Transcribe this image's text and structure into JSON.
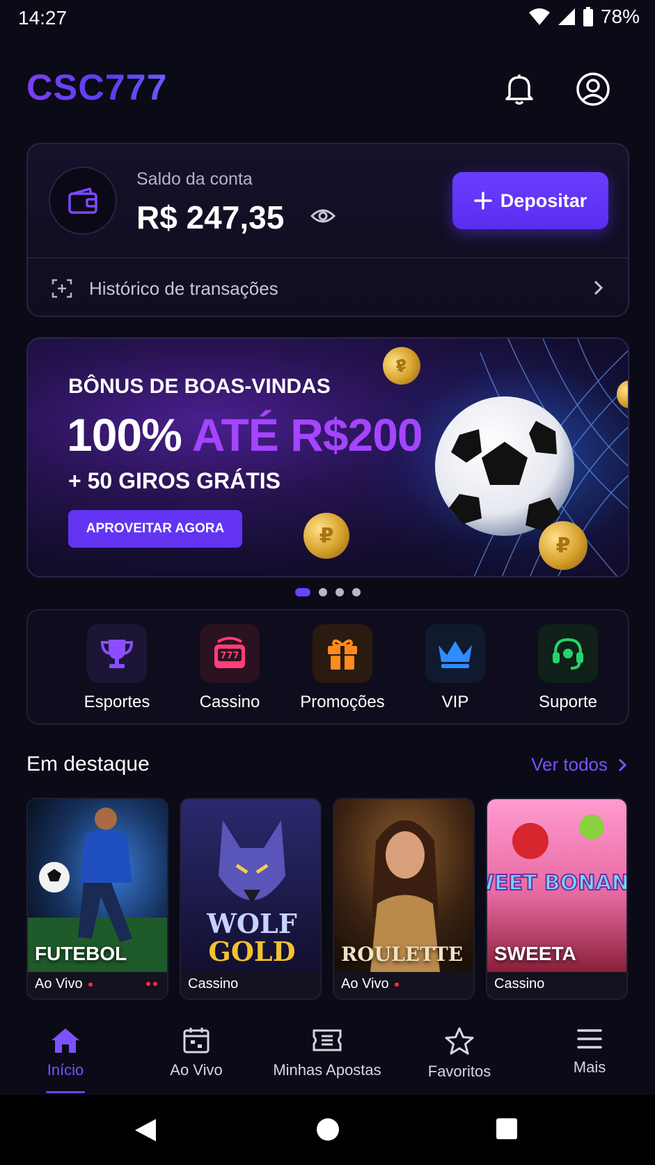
{
  "status_bar": {
    "time": "14:27",
    "battery": "78%"
  },
  "header": {
    "logo": "CSC777"
  },
  "balance": {
    "label": "Saldo da conta",
    "value": "R$ 247,35",
    "deposit_label": "Depositar",
    "history_label": "Histórico de transações"
  },
  "banner": {
    "subtitle": "BÔNUS DE BOAS-VINDAS",
    "headline_white": "100%",
    "headline_purple": "ATÉ R$200",
    "giros": "+ 50 GIROS GRÁTIS",
    "cta": "APROVEITAR AGORA",
    "slides_total": 4,
    "active_slide": 1
  },
  "categories": [
    {
      "label": "Esportes",
      "icon": "trophy-icon",
      "color": "#8b4dff"
    },
    {
      "label": "Cassino",
      "icon": "slot-machine-icon",
      "color": "#ff3d78"
    },
    {
      "label": "Promoções",
      "icon": "gift-icon",
      "color": "#ff8a1e"
    },
    {
      "label": "VIP",
      "icon": "crown-icon",
      "color": "#2f8cff"
    },
    {
      "label": "Suporte",
      "icon": "headset-icon",
      "color": "#27d36b"
    }
  ],
  "featured": {
    "title": "Em destaque",
    "see_all": "Ver todos",
    "games": [
      {
        "title": "FUTEBOL",
        "tag": "Ao Vivo",
        "live": true
      },
      {
        "title": "WOLF GOLD",
        "tag": "Cassino",
        "live": false
      },
      {
        "title": "ROULETTE",
        "tag": "Ao Vivo",
        "live": true
      },
      {
        "title": "SWEETA",
        "tag": "Cassino",
        "live": false,
        "art_text": "SWEET BONANZA"
      }
    ]
  },
  "bottom_nav": [
    {
      "label": "Início",
      "icon": "home-icon",
      "active": true
    },
    {
      "label": "Ao Vivo",
      "icon": "calendar-icon",
      "active": false
    },
    {
      "label": "Minhas Apostas",
      "icon": "ticket-icon",
      "active": false
    },
    {
      "label": "Favoritos",
      "icon": "star-icon",
      "active": false
    },
    {
      "label": "Mais",
      "icon": "menu-icon",
      "active": false
    }
  ]
}
